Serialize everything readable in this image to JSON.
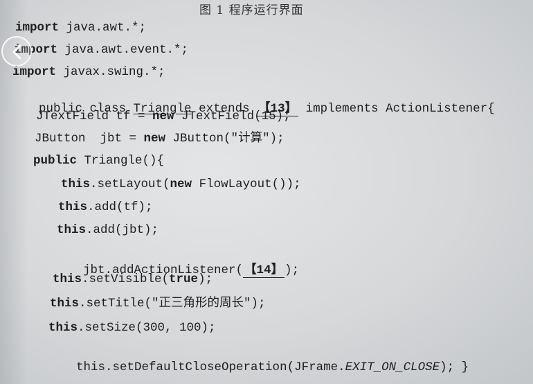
{
  "caption": "图 1  程序运行界面",
  "code": {
    "l1": "import java.awt.*;",
    "l2": "import java.awt.event.*;",
    "l3": "import javax.swing.*;",
    "l4": {
      "a": "public class ",
      "b": "Triangle",
      "c": " extends ",
      "d": "【13】",
      "e": " implements ActionListener{"
    },
    "l5": "JTextField tf = new JTextField(15);",
    "l6": "JButton  jbt = new JButton(\"计算\");",
    "l7": "public Triangle(){",
    "l8": "this.setLayout(new FlowLayout());",
    "l9": "this.add(tf);",
    "l10": "this.add(jbt);",
    "l11": {
      "a": "jbt.addActionListener(",
      "b": "【14】",
      "c": ");"
    },
    "l12": "this.setVisible(true);",
    "l13": "this.setTitle(\"正三角形的周长\");",
    "l14": "this.setSize(300, 100);",
    "l15": {
      "a": "this.setDefaultCloseOperation(JFrame.",
      "b": "EXIT_ON_CLOSE",
      "c": "); }"
    }
  },
  "nav": {
    "icon": "chevron-left-icon"
  }
}
